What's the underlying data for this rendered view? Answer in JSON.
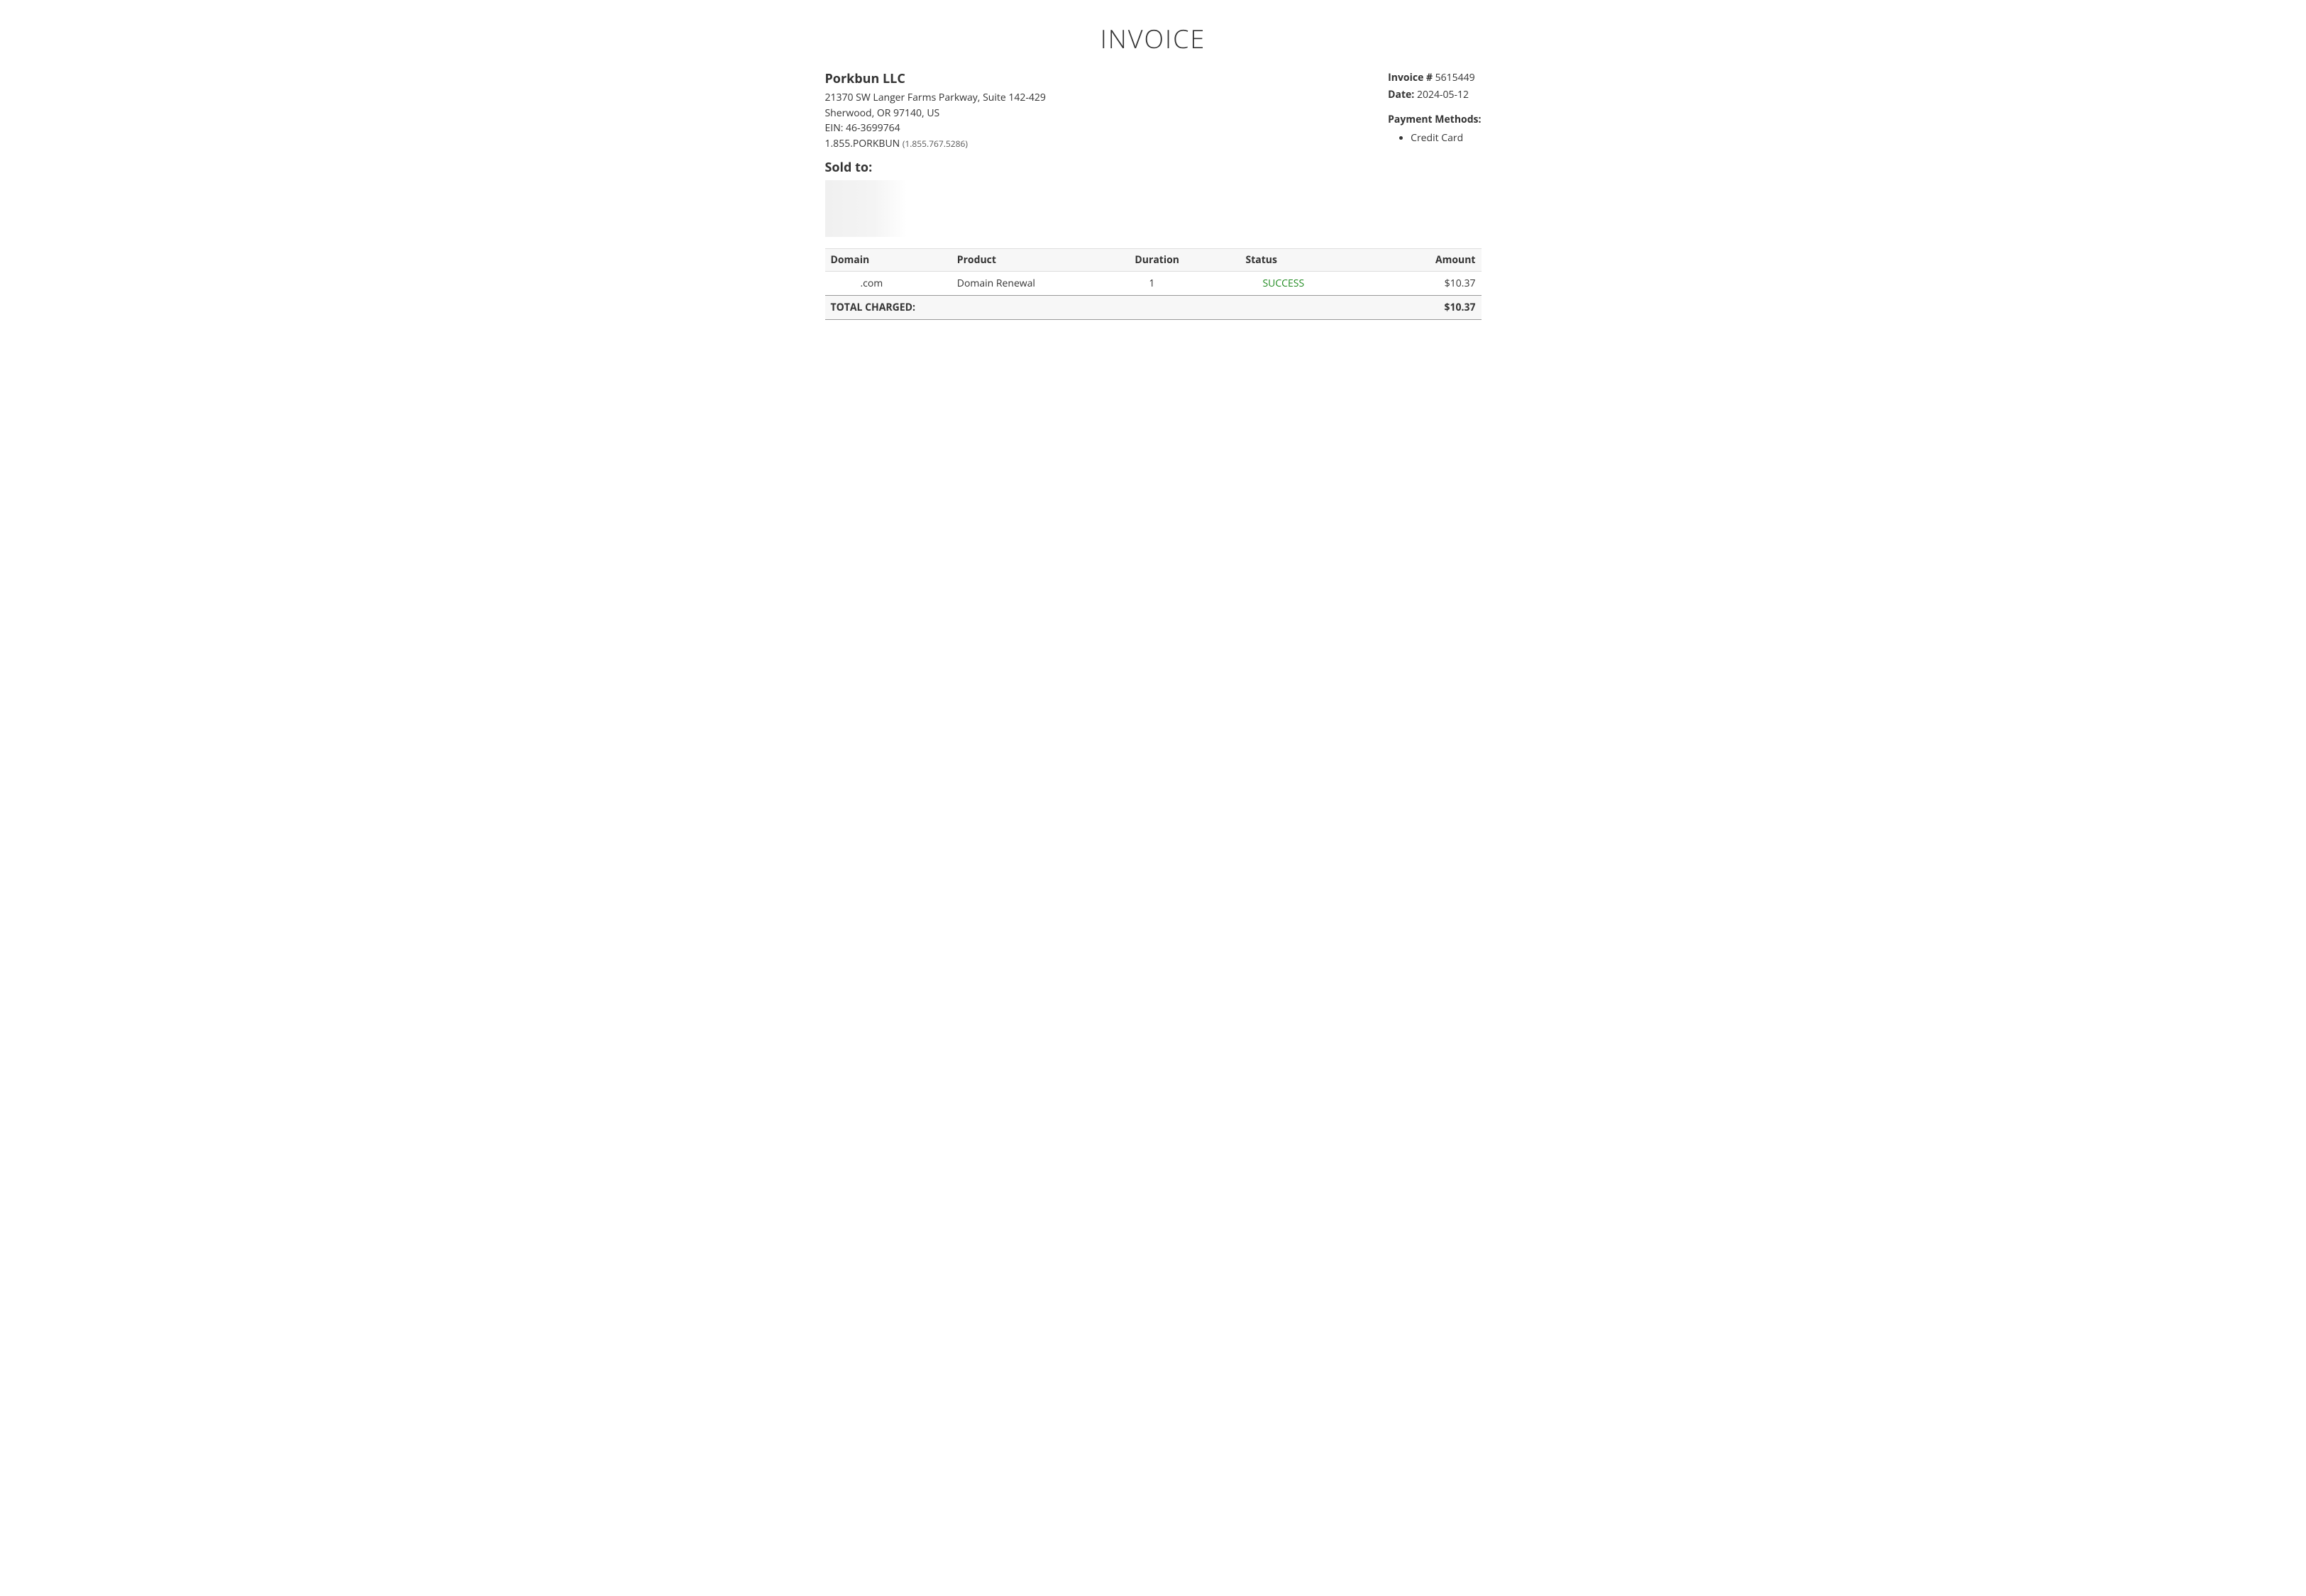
{
  "title": "INVOICE",
  "company": {
    "name": "Porkbun LLC",
    "address_line1": "21370 SW Langer Farms Parkway, Suite 142-429",
    "address_line2": "Sherwood, OR 97140, US",
    "ein": "EIN: 46-3699764",
    "phone_vanity": "1.855.PORKBUN",
    "phone_numeric": "(1.855.767.5286)"
  },
  "meta": {
    "invoice_label": "Invoice #",
    "invoice_number": "5615449",
    "date_label": "Date:",
    "date_value": "2024-05-12",
    "payment_methods_heading": "Payment Methods:",
    "payment_methods": [
      "Credit Card"
    ]
  },
  "sold_to": {
    "heading": "Sold to:"
  },
  "table": {
    "headers": {
      "domain": "Domain",
      "product": "Product",
      "duration": "Duration",
      "status": "Status",
      "amount": "Amount"
    },
    "rows": [
      {
        "domain": ".com",
        "product": "Domain Renewal",
        "duration": "1",
        "status": "SUCCESS",
        "amount": "$10.37"
      }
    ],
    "total_label": "TOTAL CHARGED:",
    "total_amount": "$10.37"
  }
}
